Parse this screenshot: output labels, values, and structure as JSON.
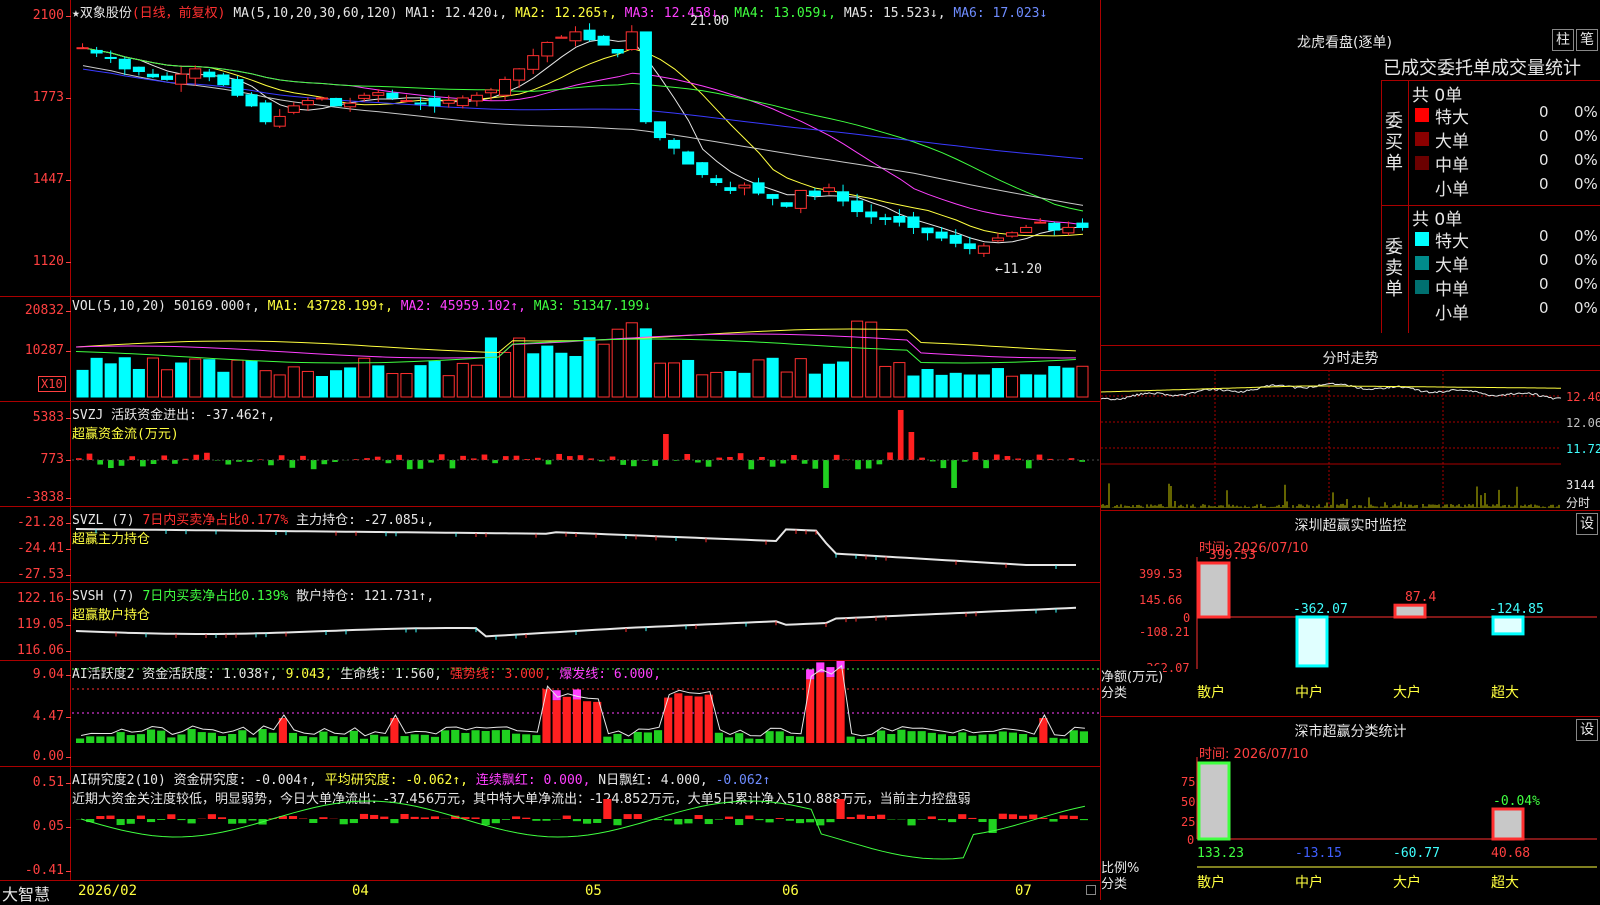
{
  "header": {
    "stock_name": "★双象股份",
    "period": "(日线，前复权)",
    "ma_label": "MA(5,10,20,30,60,120)",
    "ma1": "MA1: 12.420↓,",
    "ma2": "MA2: 12.265↑,",
    "ma3": "MA3: 12.458↓,",
    "ma4": "MA4: 13.059↓,",
    "ma5": "MA5: 15.523↓,",
    "ma6": "MA6: 17.023↓"
  },
  "price_axis": [
    "2100",
    "1773",
    "1447",
    "1120"
  ],
  "price_marks": {
    "high": "21.00",
    "low": "←11.20"
  },
  "vol": {
    "head": "VOL(5,10,20)",
    "value": "50169.000↑,",
    "ma1": "MA1: 43728.199↑,",
    "ma2": "MA2: 45959.102↑,",
    "ma3": "MA3: 51347.199↓",
    "axis": [
      "20832",
      "10287"
    ],
    "unit": "X10"
  },
  "svzj": {
    "head": "SVZJ  活跃资金进出: -37.462↑,",
    "sub": "超赢资金流(万元)",
    "axis": [
      "5383",
      "773",
      "-3838"
    ]
  },
  "svzl": {
    "head1": "SVZL (7)",
    "head2": "7日内买卖净占比0.177%",
    "head3": "主力持仓: -27.085↓,",
    "sub": "超赢主力持仓",
    "axis": [
      "-21.28",
      "-24.41",
      "-27.53"
    ]
  },
  "svsh": {
    "head1": "SVSH (7)",
    "head2": "7日内买卖净占比0.139%",
    "head3": "散户持仓: 121.731↑,",
    "sub": "超赢散户持仓",
    "axis": [
      "122.16",
      "119.05",
      "116.06"
    ]
  },
  "ai1": {
    "h1": "AI活跃度2 资金活跃度: 1.038↑,",
    "h2": "9.043,",
    "h3": "生命线: 1.560,",
    "h4": "强势线: 3.000,",
    "h5": "爆发线: 6.000,",
    "axis": [
      "9.04",
      "4.47",
      "0.00"
    ]
  },
  "ai2": {
    "h1": "AI研究度2(10) 资金研究度: -0.004↑,",
    "h2": "平均研究度: -0.062↑,",
    "h3": "连续飘红: 0.000,",
    "h4": "N日飘红: 4.000,",
    "h5": "-0.062↑",
    "note": "近期大资金关注度较低，明显弱势，今日大单净流出：-37.456万元，其中特大单净流出：-124.852万元，大单5日累计净入510.888万元，当前主力控盘弱",
    "axis": [
      "0.51",
      "0.05",
      "-0.41"
    ]
  },
  "dates": [
    "2026/02",
    "04",
    "05",
    "06",
    "07"
  ],
  "brand": "大智慧",
  "right": {
    "lhb_title": "龙虎看盘(逐单)",
    "btn_zhu": "柱",
    "btn_bi": "笔",
    "tabs": "已成交委托单成交量统计",
    "buy_label": "委买单",
    "sell_label": "委卖单",
    "buy_total": "共 0单",
    "sell_total": "共 0单",
    "buy_rows": [
      {
        "label": "特大",
        "count": "0",
        "pct": "0%",
        "color": "#ff0000"
      },
      {
        "label": "大单",
        "count": "0",
        "pct": "0%",
        "color": "#8b0000"
      },
      {
        "label": "中单",
        "count": "0",
        "pct": "0%",
        "color": "#6b0000"
      },
      {
        "label": "小单",
        "count": "0",
        "pct": "0%",
        "color": "#000000"
      }
    ],
    "sell_rows": [
      {
        "label": "特大",
        "count": "0",
        "pct": "0%",
        "color": "#00ffff"
      },
      {
        "label": "大单",
        "count": "0",
        "pct": "0%",
        "color": "#008b8b"
      },
      {
        "label": "中单",
        "count": "0",
        "pct": "0%",
        "color": "#007070"
      },
      {
        "label": "小单",
        "count": "0",
        "pct": "0%",
        "color": "#000000"
      }
    ],
    "fenshi_title": "分时走势",
    "fenshi_axis": [
      "12.40",
      "12.06",
      "11.72",
      "3144"
    ],
    "fenshi_unit": "分时",
    "monitor_title": "深圳超赢实时监控",
    "monitor_btn": "设",
    "monitor_time": "时间: 2026/07/10",
    "monitor_axis": [
      "399.53",
      "145.66",
      "0",
      "-108.21",
      "-362.07"
    ],
    "monitor_side": [
      "净额(万元)",
      "分类"
    ],
    "monitor_bars": [
      {
        "cat": "散户",
        "value": "399.53",
        "v": 399.53
      },
      {
        "cat": "中户",
        "value": "-362.07",
        "v": -362.07
      },
      {
        "cat": "大户",
        "value": "87.4",
        "v": 87.4
      },
      {
        "cat": "超大",
        "value": "-124.85",
        "v": -124.85
      }
    ],
    "class_title": "深市超赢分类统计",
    "class_btn": "设",
    "class_time": "时间: 2026/07/10",
    "class_axis": [
      "75",
      "50",
      "25",
      "0"
    ],
    "class_side": [
      "比例%",
      "分类"
    ],
    "class_bars": [
      {
        "cat": "散户",
        "value": "133.23",
        "v": 133.23
      },
      {
        "cat": "中户",
        "value": "-13.15",
        "v": -13.15
      },
      {
        "cat": "大户",
        "value": "-60.77",
        "v": -60.77
      },
      {
        "cat": "超大",
        "value": "40.68",
        "v": 40.68
      }
    ],
    "class_top_label": "-0.04%"
  },
  "chart_data": {
    "type": "candlestick",
    "ylim": [
      1120,
      2100
    ],
    "close_series": [
      1980,
      1960,
      1940,
      1900,
      1890,
      1870,
      1860,
      1880,
      1900,
      1870,
      1840,
      1800,
      1760,
      1700,
      1720,
      1760,
      1780,
      1790,
      1760,
      1770,
      1800,
      1810,
      1790,
      1780,
      1770,
      1760,
      1780,
      1790,
      1800,
      1820,
      1860,
      1900,
      1950,
      2000,
      2020,
      2040,
      2010,
      1990,
      1960,
      2040,
      1700,
      1640,
      1600,
      1540,
      1500,
      1470,
      1440,
      1460,
      1430,
      1410,
      1380,
      1440,
      1420,
      1450,
      1400,
      1360,
      1340,
      1330,
      1320,
      1300,
      1280,
      1260,
      1240,
      1220,
      1230,
      1260,
      1280,
      1300,
      1320,
      1290,
      1300,
      1300
    ]
  }
}
